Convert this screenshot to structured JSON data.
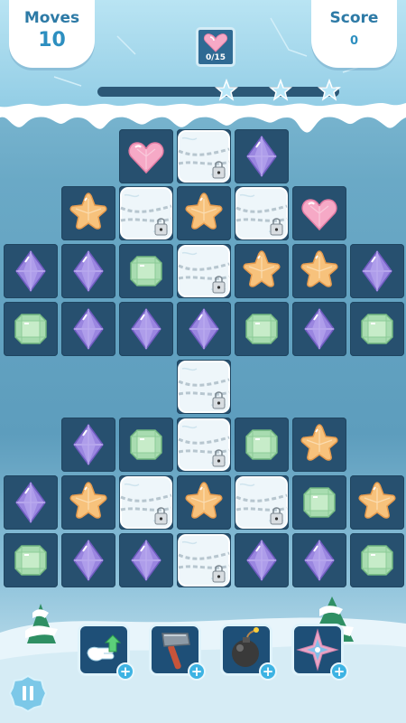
{
  "hud": {
    "moves_label": "Moves",
    "moves_value": "10",
    "score_label": "Score",
    "score_value": "0",
    "goal_icon": "pink-heart-gem-icon",
    "goal_text": "0/15",
    "star_progress": 0
  },
  "board": {
    "rows": [
      [
        "empty",
        "empty",
        "heart",
        "ice-chained",
        "diamond",
        "empty",
        "empty"
      ],
      [
        "empty",
        "star",
        "ice-chained",
        "star",
        "ice-chained",
        "heart",
        "empty"
      ],
      [
        "diamond",
        "diamond",
        "emerald",
        "ice-chained",
        "star",
        "star",
        "diamond"
      ],
      [
        "emerald",
        "diamond",
        "diamond",
        "diamond",
        "emerald",
        "diamond",
        "emerald"
      ],
      [
        "empty",
        "empty",
        "empty",
        "ice-chained",
        "empty",
        "empty",
        "empty"
      ],
      [
        "empty",
        "diamond",
        "emerald",
        "ice-chained",
        "emerald",
        "star",
        "empty"
      ],
      [
        "diamond",
        "star",
        "ice-chained",
        "star",
        "ice-chained",
        "emerald",
        "star"
      ],
      [
        "emerald",
        "diamond",
        "diamond",
        "ice-chained",
        "diamond",
        "diamond",
        "emerald"
      ]
    ]
  },
  "boosters": [
    {
      "name": "hand-swap-booster",
      "icon": "glove-hand-arrow-icon",
      "plus": "+"
    },
    {
      "name": "hammer-booster",
      "icon": "hammer-icon",
      "plus": "+"
    },
    {
      "name": "bomb-booster",
      "icon": "bomb-icon",
      "plus": "+"
    },
    {
      "name": "shuriken-booster",
      "icon": "shuriken-icon",
      "plus": "+"
    }
  ],
  "pause": {
    "icon": "pause-icon"
  },
  "colors": {
    "heart": "#f6a9c6",
    "diamond": "#9a86e0",
    "emerald": "#a8dcb0",
    "star": "#f7c27c",
    "cell": "#27506f",
    "ice": "#eef6fa"
  }
}
